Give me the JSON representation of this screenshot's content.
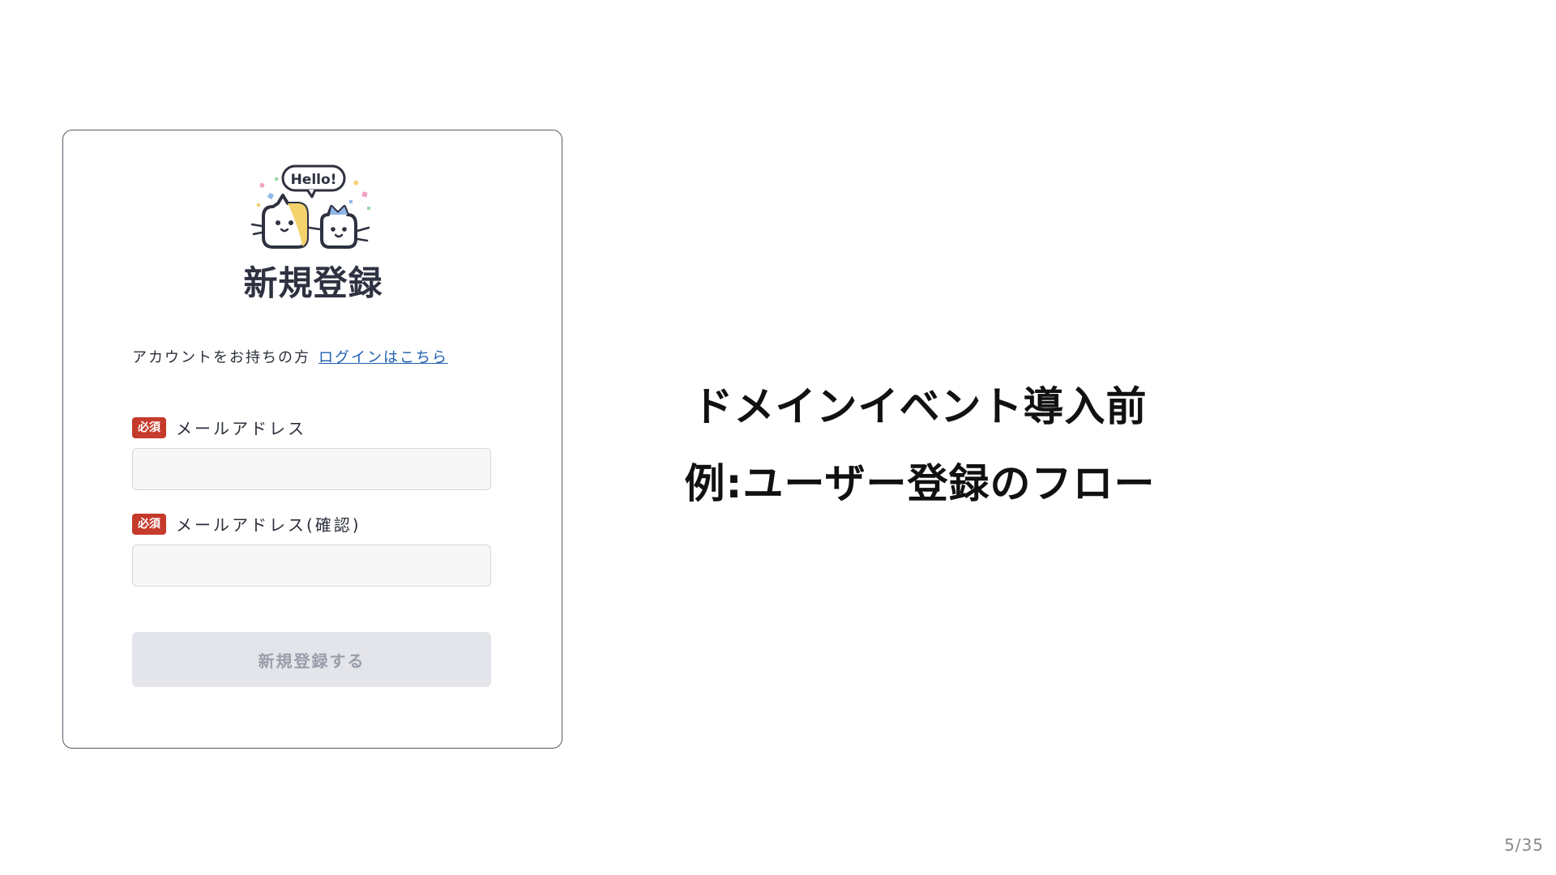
{
  "form": {
    "logo_text": "Hello!",
    "title": "新規登録",
    "login_prompt": "アカウントをお持ちの方",
    "login_link": "ログインはこちら",
    "fields": [
      {
        "badge": "必須",
        "label": "メールアドレス",
        "value": ""
      },
      {
        "badge": "必須",
        "label": "メールアドレス(確認)",
        "value": ""
      }
    ],
    "submit_label": "新規登録する"
  },
  "slide": {
    "headline_1": "ドメインイベント導入前",
    "headline_2": "例:ユーザー登録のフロー",
    "page_number": "5/35"
  },
  "colors": {
    "required_badge": "#c63a2b",
    "link": "#1e5fb0",
    "submit_disabled_bg": "#e4e5ea",
    "submit_disabled_text": "#9a9eaa",
    "logo_yellow": "#f3d26b",
    "logo_blue": "#8fb8e6"
  }
}
